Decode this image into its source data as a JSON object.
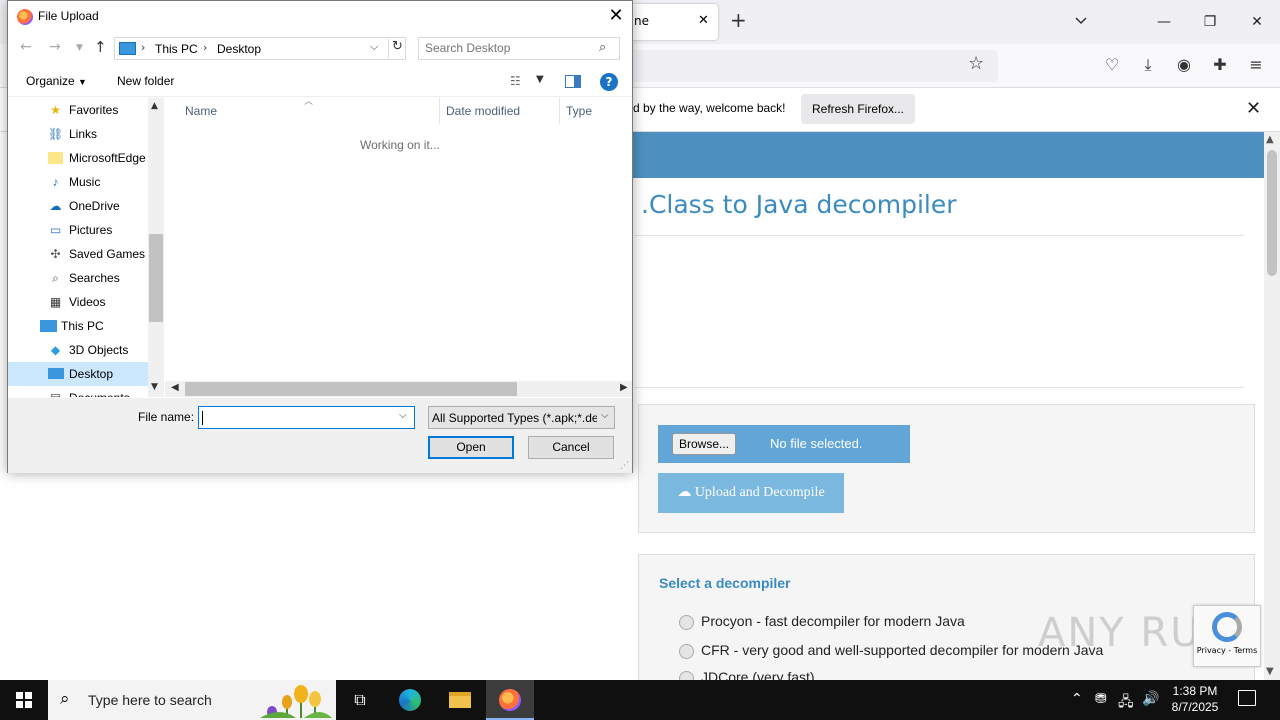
{
  "browser": {
    "tab_title_fragment": "ne",
    "notification_text": "d by the way, welcome back!",
    "refresh_button": "Refresh Firefox..."
  },
  "page": {
    "title": ".Class to Java decompiler",
    "browse_button": "Browse...",
    "file_status": "No file selected.",
    "upload_button": "Upload and Decompile",
    "decompiler_heading": "Select a decompiler",
    "decompiler_options": [
      "Procyon - fast decompiler for modern Java",
      "CFR - very good and well-supported decompiler for modern Java",
      "JDCore (very fast)"
    ],
    "watermark": "ANY RUN",
    "recaptcha_links": "Privacy - Terms"
  },
  "dialog": {
    "title": "File Upload",
    "breadcrumb": [
      "This PC",
      "Desktop"
    ],
    "search_placeholder": "Search Desktop",
    "organize": "Organize",
    "new_folder": "New folder",
    "help": "?",
    "tree": [
      {
        "label": "Favorites",
        "icon": "star-icon",
        "indent": 1
      },
      {
        "label": "Links",
        "icon": "link-icon",
        "indent": 1
      },
      {
        "label": "MicrosoftEdge",
        "icon": "folder-icon",
        "indent": 1
      },
      {
        "label": "Music",
        "icon": "music-icon",
        "indent": 1
      },
      {
        "label": "OneDrive",
        "icon": "cloud-icon",
        "indent": 1
      },
      {
        "label": "Pictures",
        "icon": "pictures-icon",
        "indent": 1
      },
      {
        "label": "Saved Games",
        "icon": "game-icon",
        "indent": 1
      },
      {
        "label": "Searches",
        "icon": "search-icon",
        "indent": 1
      },
      {
        "label": "Videos",
        "icon": "video-icon",
        "indent": 1
      },
      {
        "label": "This PC",
        "icon": "pc-icon",
        "indent": 0
      },
      {
        "label": "3D Objects",
        "icon": "cube-icon",
        "indent": 1
      },
      {
        "label": "Desktop",
        "icon": "desktop-icon",
        "indent": 1,
        "selected": true
      },
      {
        "label": "Documents",
        "icon": "document-icon",
        "indent": 1
      }
    ],
    "columns": [
      "Name",
      "Date modified",
      "Type"
    ],
    "status": "Working on it...",
    "file_name_label": "File name:",
    "file_name_value": "",
    "file_type": "All Supported Types (*.apk;*.dex;*.jar;*.class)",
    "open_button": "Open",
    "cancel_button": "Cancel"
  },
  "taskbar": {
    "search_text": "Type here to search",
    "time": "1:38 PM",
    "date": "8/7/2025"
  },
  "colors": {
    "banner": "#4e90bf",
    "accent_blue": "#3a8bc2",
    "selection": "#cce8ff",
    "focus": "#0078d7"
  }
}
